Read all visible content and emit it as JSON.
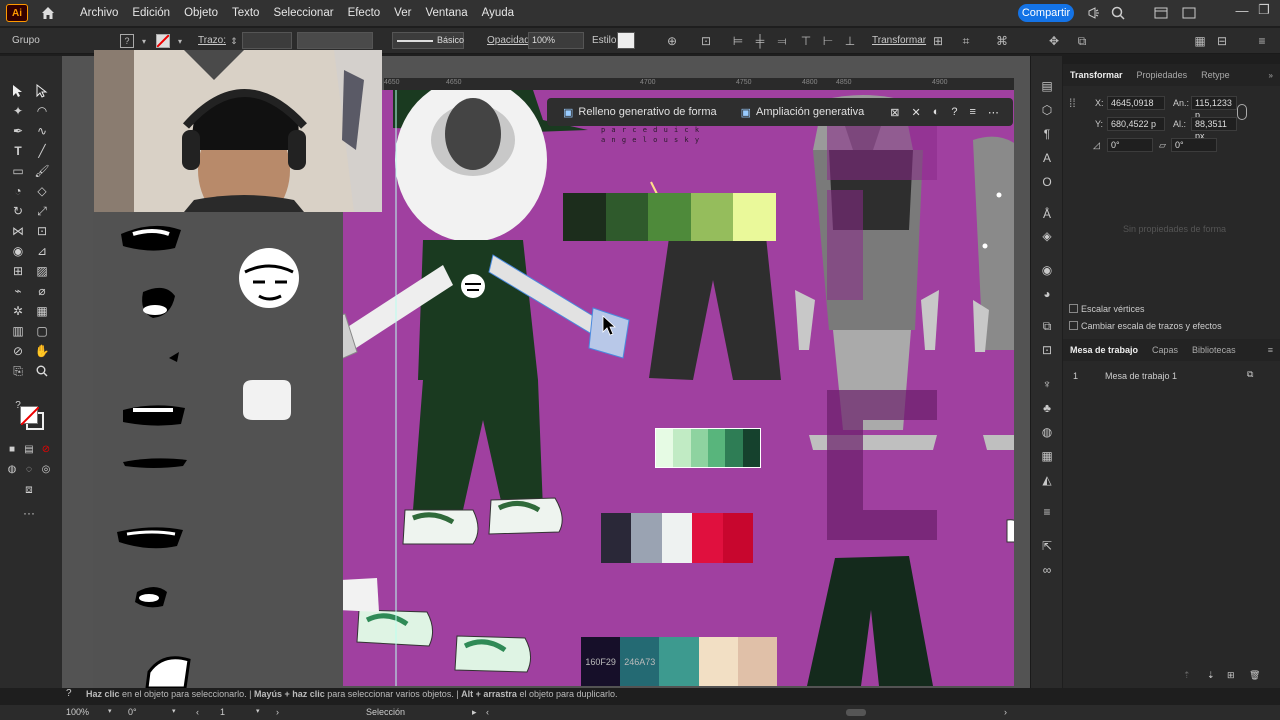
{
  "app": {
    "logo": "Ai",
    "workspace_preset": "Grupo"
  },
  "menu": [
    "Archivo",
    "Edición",
    "Objeto",
    "Texto",
    "Seleccionar",
    "Efecto",
    "Ver",
    "Ventana",
    "Ayuda"
  ],
  "share_label": "Compartir",
  "control": {
    "stroke_label": "Trazo:",
    "brush_label": "Básico",
    "opacity_label": "Opacidad:",
    "opacity_value": "100%",
    "style_label": "Estilo:",
    "transform_label": "Transformar"
  },
  "ruler": [
    "4650",
    "4700",
    "4750",
    "4800",
    "4850",
    "4900"
  ],
  "context_bar": {
    "fill_label": "Relleno generativo de forma",
    "expand_label": "Ampliación generativa"
  },
  "palette_codes": [
    "160F29",
    "246A73"
  ],
  "artwork_text": {
    "row1": "p a r c e d u i c k",
    "row2": "a n g e l o u s k y"
  },
  "panel": {
    "tabs": [
      "Transformar",
      "Propiedades",
      "Retype"
    ],
    "x_label": "X:",
    "x_value": "4645,0918",
    "y_label": "Y:",
    "y_value": "680,4522 p",
    "w_label": "An.:",
    "w_value": "115,1233 p",
    "h_label": "Al.:",
    "h_value": "88,3511 px",
    "rot_value": "0°",
    "shear_value": "0°",
    "empty_msg": "Sin propiedades de forma",
    "scale_corners": "Escalar vértices",
    "scale_strokes": "Cambiar escala de trazos y efectos",
    "layer_tabs": [
      "Mesa de trabajo",
      "Capas",
      "Bibliotecas"
    ],
    "artboard_num": "1",
    "artboard_name": "Mesa de trabajo 1"
  },
  "hint": {
    "a": "Haz clic",
    "b": " en el objeto para seleccionarlo. | ",
    "c": "Mayús + haz clic",
    "d": " para seleccionar varios objetos. | ",
    "e": "Alt + arrastra",
    "f": " el objeto para duplicarlo."
  },
  "status": {
    "zoom": "100%",
    "angle": "0°",
    "artboard": "1",
    "tool": "Selección"
  },
  "colors": {
    "accent": "#1473e6",
    "artboard": "#a040a0",
    "palette_green": [
      "#1c2d1c",
      "#2f5a2c",
      "#4e8a3a",
      "#95bd5c",
      "#eaf99a"
    ],
    "palette_mint": [
      "#e6fbe4",
      "#c1ebc4",
      "#8ed3a0",
      "#58b57c",
      "#2e7d55",
      "#15412d"
    ],
    "palette_red": [
      "#2a2838",
      "#9aa3b2",
      "#eef2f1",
      "#e0103e",
      "#c8062e"
    ],
    "palette_bottom": [
      "#160F29",
      "#246A73",
      "#3d9a8f",
      "#f2dfc4",
      "#e0c0a8"
    ]
  }
}
